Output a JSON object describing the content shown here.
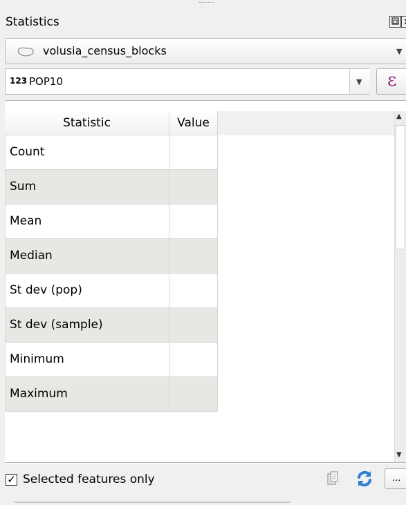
{
  "panel": {
    "title": "Statistics"
  },
  "layer_select": {
    "value": "volusia_census_blocks"
  },
  "field_select": {
    "type_badge": "123",
    "value": "POP10",
    "expression_symbol": "ε"
  },
  "table": {
    "headers": [
      "Statistic",
      "Value"
    ],
    "rows": [
      {
        "statistic": "Count",
        "value": ""
      },
      {
        "statistic": "Sum",
        "value": ""
      },
      {
        "statistic": "Mean",
        "value": ""
      },
      {
        "statistic": "Median",
        "value": ""
      },
      {
        "statistic": "St dev (pop)",
        "value": ""
      },
      {
        "statistic": "St dev (sample)",
        "value": ""
      },
      {
        "statistic": "Minimum",
        "value": ""
      },
      {
        "statistic": "Maximum",
        "value": ""
      }
    ]
  },
  "footer": {
    "selected_only_checked": true,
    "check_mark": "✓",
    "selected_only_label": "Selected features only",
    "more_button_label": "..."
  },
  "colors": {
    "expression_icon": "#9a2a7c",
    "refresh_icon": "#2f7fd0",
    "alt_row": "#e9e7e3"
  }
}
